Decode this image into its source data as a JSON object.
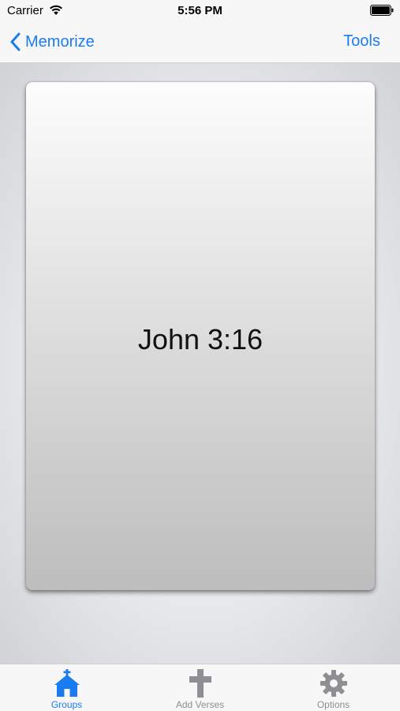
{
  "status_bar": {
    "carrier": "Carrier",
    "time": "5:56 PM"
  },
  "nav_bar": {
    "back_label": "Memorize",
    "tools_label": "Tools"
  },
  "card": {
    "reference": "John 3:16"
  },
  "tab_bar": {
    "tabs": [
      {
        "label": "Groups",
        "icon": "church-icon",
        "active": true
      },
      {
        "label": "Add Verses",
        "icon": "cross-icon",
        "active": false
      },
      {
        "label": "Options",
        "icon": "gear-icon",
        "active": false
      }
    ]
  },
  "colors": {
    "accent": "#1a7cf0",
    "inactive": "#8e8e93"
  }
}
